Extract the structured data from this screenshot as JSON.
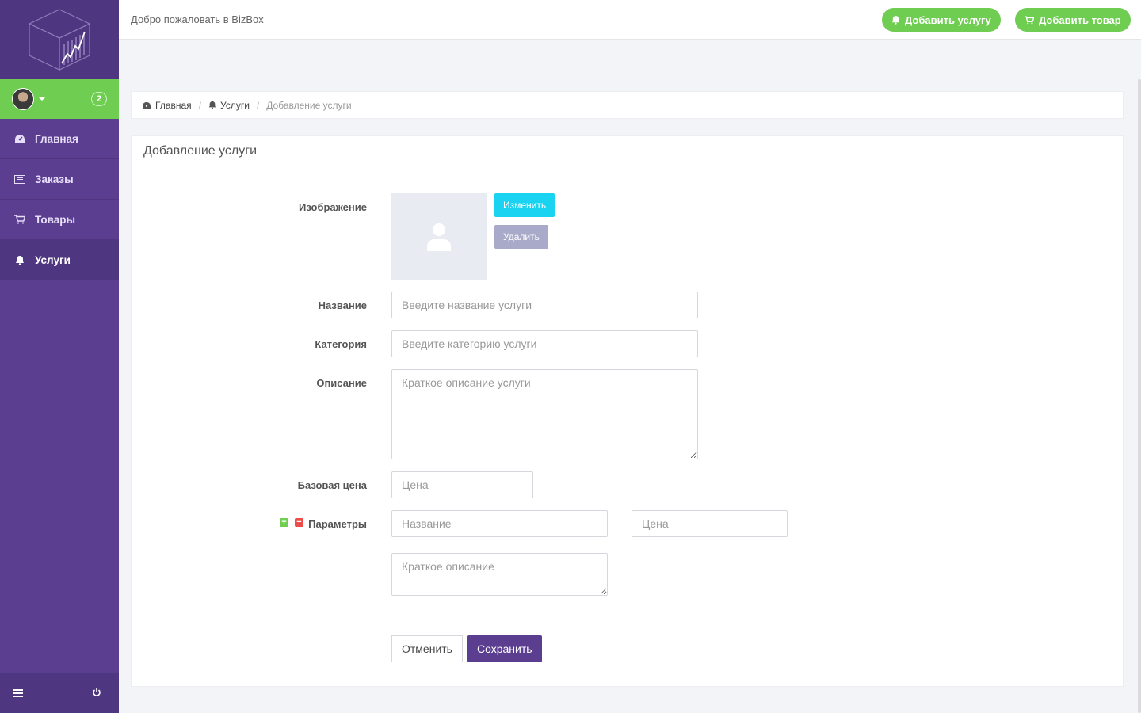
{
  "topbar": {
    "welcome": "Добро пожаловать в BizBox",
    "add_service": "Добавить услугу",
    "add_product": "Добавить товар"
  },
  "sidebar": {
    "badge": "2",
    "items": [
      {
        "label": "Главная",
        "icon": "dashboard-icon"
      },
      {
        "label": "Заказы",
        "icon": "list-icon"
      },
      {
        "label": "Товары",
        "icon": "cart-icon"
      },
      {
        "label": "Услуги",
        "icon": "bell-icon",
        "active": true
      }
    ]
  },
  "breadcrumb": {
    "home": "Главная",
    "services": "Услуги",
    "current": "Добавление услуги"
  },
  "panel": {
    "title": "Добавление услуги"
  },
  "form": {
    "image_label": "Изображение",
    "change_button": "Изменить",
    "delete_button": "Удалить",
    "name_label": "Название",
    "name_placeholder": "Введите название услуги",
    "category_label": "Категория",
    "category_placeholder": "Введите категорию услуги",
    "description_label": "Описание",
    "description_placeholder": "Краткое описание услуги",
    "price_label": "Базовая цена",
    "price_placeholder": "Цена",
    "params_label": "Параметры",
    "param_name_placeholder": "Название",
    "param_price_placeholder": "Цена",
    "param_desc_placeholder": "Краткое описание",
    "cancel_button": "Отменить",
    "save_button": "Сохранить"
  },
  "colors": {
    "sidebar": "#5b3e8f",
    "sidebar_dark": "#4f3680",
    "accent_green": "#6fce52",
    "change_button": "#1ad3f0",
    "delete_button": "#a9aac9"
  }
}
